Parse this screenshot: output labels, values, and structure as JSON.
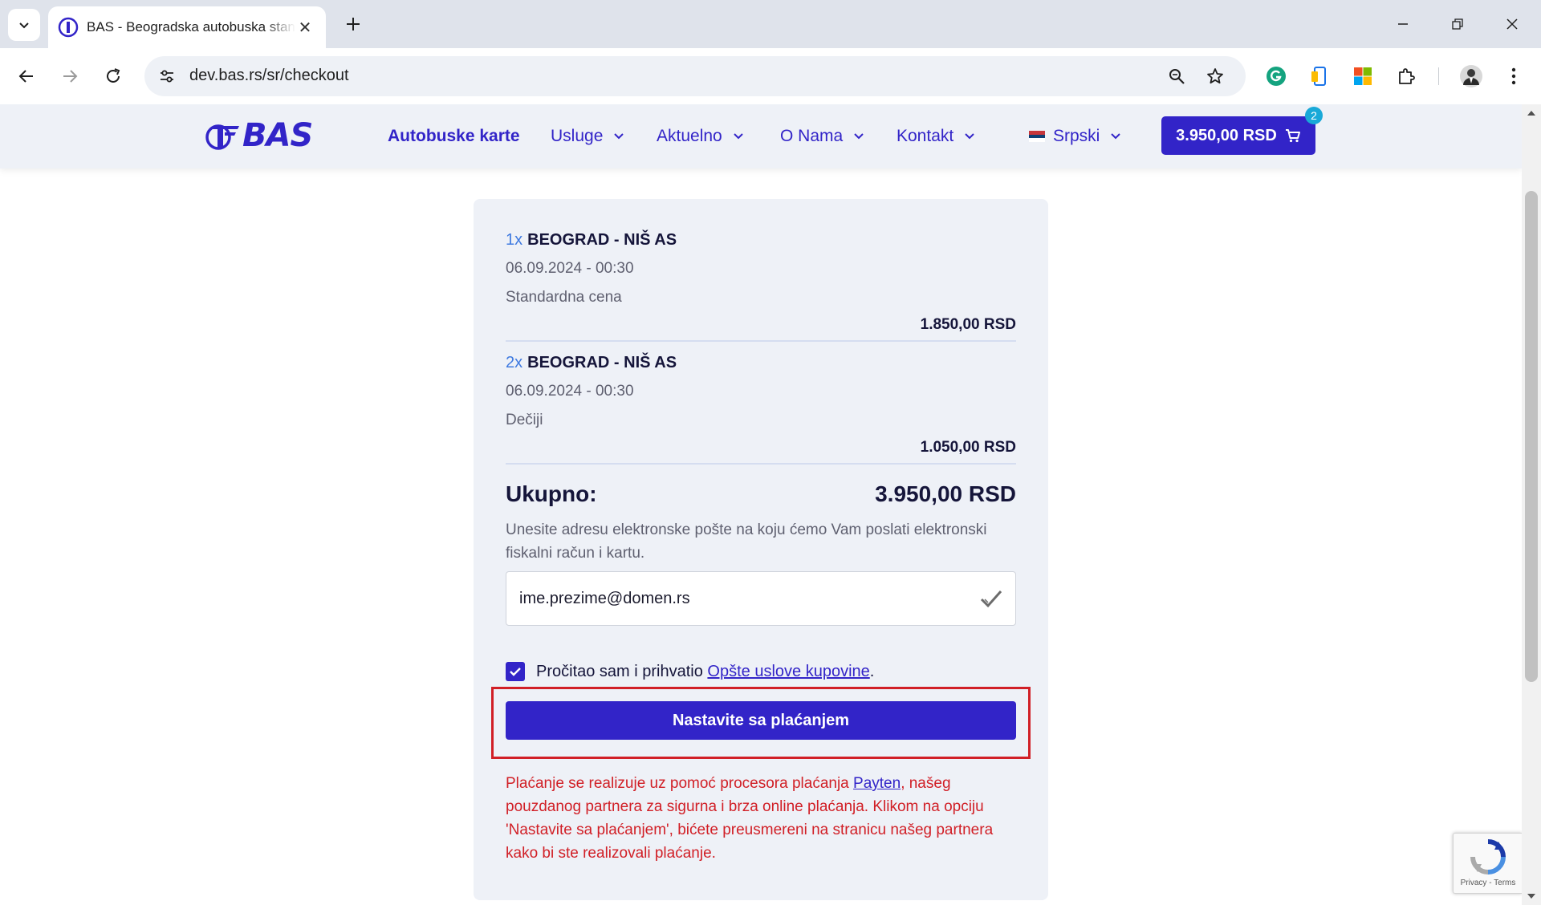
{
  "browser": {
    "tab_title": "BAS - Beogradska autobuska stanica",
    "url": "dev.bas.rs/sr/checkout"
  },
  "header": {
    "logo_text": "BAS",
    "nav": [
      {
        "label": "Autobuske karte"
      },
      {
        "label": "Usluge"
      },
      {
        "label": "Aktuelno"
      },
      {
        "label": "O Nama"
      },
      {
        "label": "Kontakt"
      }
    ],
    "language": "Srpski",
    "cart_total": "3.950,00 RSD",
    "cart_count": "2"
  },
  "checkout": {
    "items": [
      {
        "qty": "1x",
        "route": "BEOGRAD - NIŠ AS",
        "datetime": "06.09.2024 - 00:30",
        "fare": "Standardna cena",
        "price": "1.850,00 RSD"
      },
      {
        "qty": "2x",
        "route": "BEOGRAD - NIŠ AS",
        "datetime": "06.09.2024 - 00:30",
        "fare": "Dečiji",
        "price": "1.050,00 RSD"
      }
    ],
    "total_label": "Ukupno:",
    "total_value": "3.950,00 RSD",
    "instructions": "Unesite adresu elektronske pošte na koju ćemo Vam poslati elektronski fiskalni račun i kartu.",
    "email_value": "ime.prezime@domen.rs",
    "terms_prefix": "Pročitao sam i prihvatio ",
    "terms_link": "Opšte uslove kupovine",
    "terms_suffix": ".",
    "terms_checked": true,
    "pay_button": "Nastavite sa plaćanjem",
    "notice_prefix": "Plaćanje se realizuje uz pomoć procesora plaćanja ",
    "notice_link": "Payten",
    "notice_suffix": ", našeg pouzdanog partnera za sigurna i brza online plaćanja. Klikom na opciju 'Nastavite sa plaćanjem', bićete preusmereni na stranicu našeg partnera kako bi ste realizovali plaćanje."
  },
  "recaptcha": {
    "text": "Privacy - Terms"
  },
  "colors": {
    "brand": "#3224c8",
    "qty_accent": "#3f7ae0",
    "notice_red": "#d11f26",
    "highlight_red": "#d11f26",
    "badge": "#19a9d8"
  }
}
